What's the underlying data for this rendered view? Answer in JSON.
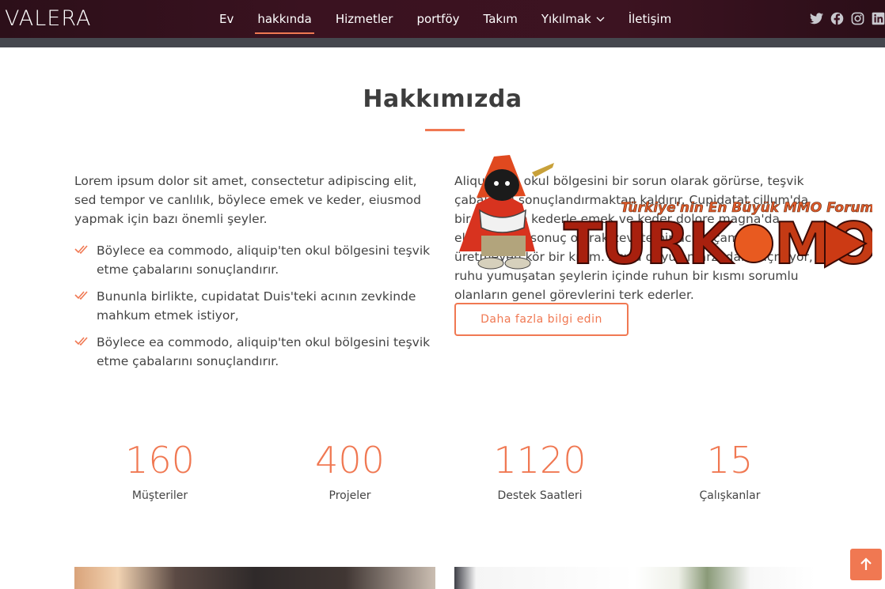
{
  "header": {
    "logo": "VALERA",
    "nav": [
      {
        "label": "Ev"
      },
      {
        "label": "hakkında"
      },
      {
        "label": "Hizmetler"
      },
      {
        "label": "portföy"
      },
      {
        "label": "Takım"
      },
      {
        "label": "Yıkılmak"
      },
      {
        "label": "İletişim"
      }
    ],
    "active_nav": "hakkında",
    "social_icons": [
      "twitter-icon",
      "facebook-icon",
      "instagram-icon",
      "linkedin-icon"
    ]
  },
  "about": {
    "title": "Hakkımızda",
    "left_paragraph": "Lorem ipsum dolor sit amet, consectetur adipiscing elit, sed tempor ve canlılık, böylece emek ve keder, eiusmod yapmak için bazı önemli şeyler.",
    "list": [
      "Böylece ea commodo, aliquip'ten okul bölgesini teşvik etme çabalarını sonuçlandırır.",
      "Bununla birlikte, cupidatat Duis'teki acının zevkinde mahkum etmek istiyor,",
      "Böylece ea commodo, aliquip'ten okul bölgesini teşvik etme çabalarını sonuçlandırır."
    ],
    "right_paragraph": "Aliquip'ten okul bölgesini bir sorun olarak görürse, teşvik çabalarını sonuçlandırmaktan kaldırır. Cupidatat cillum'da bir emek ve kederle emek ve keder dolore magna'da eleştiriliyor, sonuç olarak zevkte bir acı kaçamak üretmeyen kör bir kısım. Acıya duyulan arzudan kaçmıyor, ruhu yumuşatan şeylerin içinde ruhun bir kısmı sorumlu olanların genel görevlerini terk ederler.",
    "button": "Daha fazla bilgi edin"
  },
  "watermark": {
    "tagline": "Türkiye'nin En Büyük MMO Forumu",
    "brand": "TURKMMO"
  },
  "counters": [
    {
      "value": "160",
      "label": "Müşteriler"
    },
    {
      "value": "400",
      "label": "Projeler"
    },
    {
      "value": "1120",
      "label": "Destek Saatleri"
    },
    {
      "value": "15",
      "label": "Çalışkanlar"
    }
  ],
  "colors": {
    "accent": "#f07852",
    "header_bg": "#3a1220",
    "text": "#444444"
  }
}
